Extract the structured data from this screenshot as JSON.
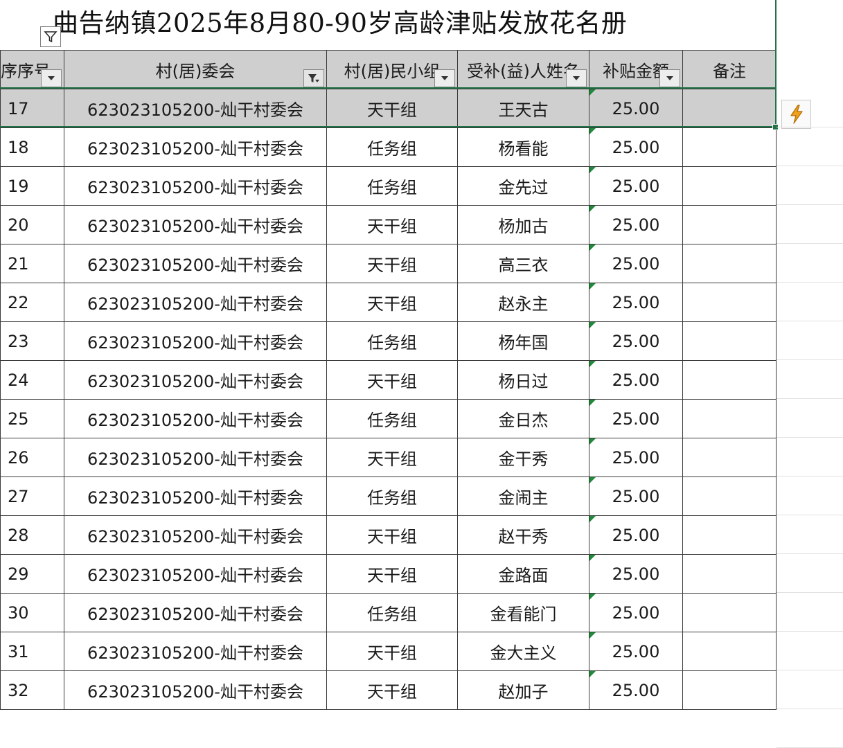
{
  "sheet": {
    "title": "曲告纳镇2025年8月80-90岁高龄津贴发放花名册",
    "headers": {
      "seq": "序序号",
      "committee": "村(居)委会",
      "group": "村(居)民小组",
      "name": "受补(益)人姓名",
      "amount": "补贴金额",
      "note": "备注"
    },
    "rows": [
      {
        "seq": "17",
        "committee": "623023105200-灿干村委会",
        "group": "天干组",
        "name": "王天古",
        "amount": "25.00",
        "note": ""
      },
      {
        "seq": "18",
        "committee": "623023105200-灿干村委会",
        "group": "任务组",
        "name": "杨看能",
        "amount": "25.00",
        "note": ""
      },
      {
        "seq": "19",
        "committee": "623023105200-灿干村委会",
        "group": "任务组",
        "name": "金先过",
        "amount": "25.00",
        "note": ""
      },
      {
        "seq": "20",
        "committee": "623023105200-灿干村委会",
        "group": "天干组",
        "name": "杨加古",
        "amount": "25.00",
        "note": ""
      },
      {
        "seq": "21",
        "committee": "623023105200-灿干村委会",
        "group": "天干组",
        "name": "高三衣",
        "amount": "25.00",
        "note": ""
      },
      {
        "seq": "22",
        "committee": "623023105200-灿干村委会",
        "group": "天干组",
        "name": "赵永主",
        "amount": "25.00",
        "note": ""
      },
      {
        "seq": "23",
        "committee": "623023105200-灿干村委会",
        "group": "任务组",
        "name": "杨年国",
        "amount": "25.00",
        "note": ""
      },
      {
        "seq": "24",
        "committee": "623023105200-灿干村委会",
        "group": "天干组",
        "name": "杨日过",
        "amount": "25.00",
        "note": ""
      },
      {
        "seq": "25",
        "committee": "623023105200-灿干村委会",
        "group": "任务组",
        "name": "金日杰",
        "amount": "25.00",
        "note": ""
      },
      {
        "seq": "26",
        "committee": "623023105200-灿干村委会",
        "group": "天干组",
        "name": "金干秀",
        "amount": "25.00",
        "note": ""
      },
      {
        "seq": "27",
        "committee": "623023105200-灿干村委会",
        "group": "任务组",
        "name": "金闹主",
        "amount": "25.00",
        "note": ""
      },
      {
        "seq": "28",
        "committee": "623023105200-灿干村委会",
        "group": "天干组",
        "name": "赵干秀",
        "amount": "25.00",
        "note": ""
      },
      {
        "seq": "29",
        "committee": "623023105200-灿干村委会",
        "group": "天干组",
        "name": "金路面",
        "amount": "25.00",
        "note": ""
      },
      {
        "seq": "30",
        "committee": "623023105200-灿干村委会",
        "group": "任务组",
        "name": "金看能门",
        "amount": "25.00",
        "note": ""
      },
      {
        "seq": "31",
        "committee": "623023105200-灿干村委会",
        "group": "天干组",
        "name": "金大主义",
        "amount": "25.00",
        "note": ""
      },
      {
        "seq": "32",
        "committee": "623023105200-灿干村委会",
        "group": "天干组",
        "name": "赵加子",
        "amount": "25.00",
        "note": ""
      }
    ],
    "selected_row_index": 0
  },
  "icons": {
    "title_filter": "filter-icon",
    "header_dropdown": "chevron-down-icon",
    "active_filter": "filter-active-icon",
    "quick_action": "lightning-icon"
  },
  "colors": {
    "header_bg": "#cfcfcf",
    "selection_border": "#217346",
    "number_marker": "#1f8a3a",
    "flash_orange": "#f0a11c"
  }
}
